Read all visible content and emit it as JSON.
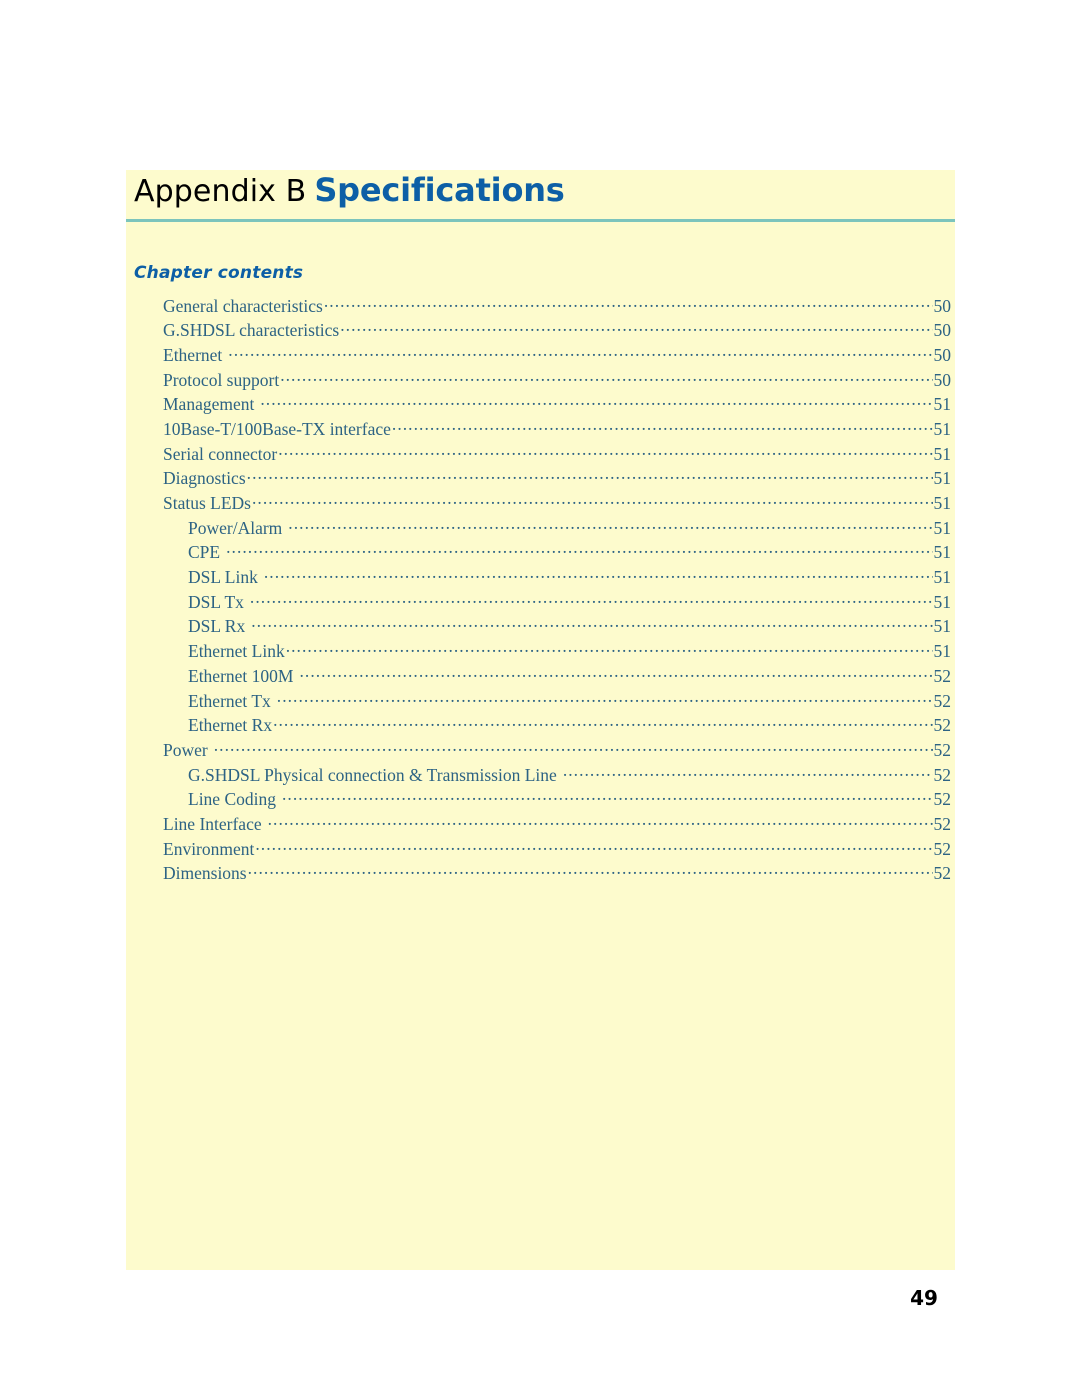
{
  "colors": {
    "panel_background": "#fdfbcd",
    "title_accent": "#0d5fa6",
    "rule": "#7cc4bc",
    "toc_text": "#2d6384",
    "page_background": "#ffffff"
  },
  "header": {
    "prefix": "Appendix B",
    "title": "Specifications"
  },
  "contents": {
    "heading": "Chapter contents",
    "entries": [
      {
        "label": "General characteristics",
        "page": "50",
        "level": 1,
        "gap": false
      },
      {
        "label": "G.SHDSL characteristics",
        "page": "50",
        "level": 1,
        "gap": false
      },
      {
        "label": "Ethernet",
        "page": "50",
        "level": 1,
        "gap": true
      },
      {
        "label": "Protocol support",
        "page": "50",
        "level": 1,
        "gap": false
      },
      {
        "label": "Management",
        "page": "51",
        "level": 1,
        "gap": true
      },
      {
        "label": "10Base-T/100Base-TX interface",
        "page": "51",
        "level": 1,
        "gap": false
      },
      {
        "label": "Serial connector",
        "page": "51",
        "level": 1,
        "gap": false
      },
      {
        "label": "Diagnostics",
        "page": "51",
        "level": 1,
        "gap": false
      },
      {
        "label": "Status LEDs",
        "page": "51",
        "level": 1,
        "gap": false
      },
      {
        "label": "Power/Alarm",
        "page": "51",
        "level": 2,
        "gap": true
      },
      {
        "label": "CPE",
        "page": "51",
        "level": 2,
        "gap": true
      },
      {
        "label": "DSL Link",
        "page": "51",
        "level": 2,
        "gap": true
      },
      {
        "label": "DSL Tx",
        "page": "51",
        "level": 2,
        "gap": true
      },
      {
        "label": "DSL Rx",
        "page": "51",
        "level": 2,
        "gap": true
      },
      {
        "label": "Ethernet Link",
        "page": "51",
        "level": 2,
        "gap": false
      },
      {
        "label": "Ethernet 100M",
        "page": "52",
        "level": 2,
        "gap": true
      },
      {
        "label": "Ethernet Tx",
        "page": "52",
        "level": 2,
        "gap": true
      },
      {
        "label": "Ethernet Rx",
        "page": "52",
        "level": 2,
        "gap": false
      },
      {
        "label": "Power",
        "page": "52",
        "level": 1,
        "gap": true
      },
      {
        "label": "G.SHDSL Physical connection & Transmission Line",
        "page": "52",
        "level": 2,
        "gap": true
      },
      {
        "label": "Line Coding",
        "page": "52",
        "level": 2,
        "gap": true
      },
      {
        "label": "Line Interface",
        "page": "52",
        "level": 1,
        "gap": true
      },
      {
        "label": "Environment",
        "page": "52",
        "level": 1,
        "gap": false
      },
      {
        "label": "Dimensions",
        "page": "52",
        "level": 1,
        "gap": false
      }
    ]
  },
  "footer": {
    "folio": "49"
  }
}
